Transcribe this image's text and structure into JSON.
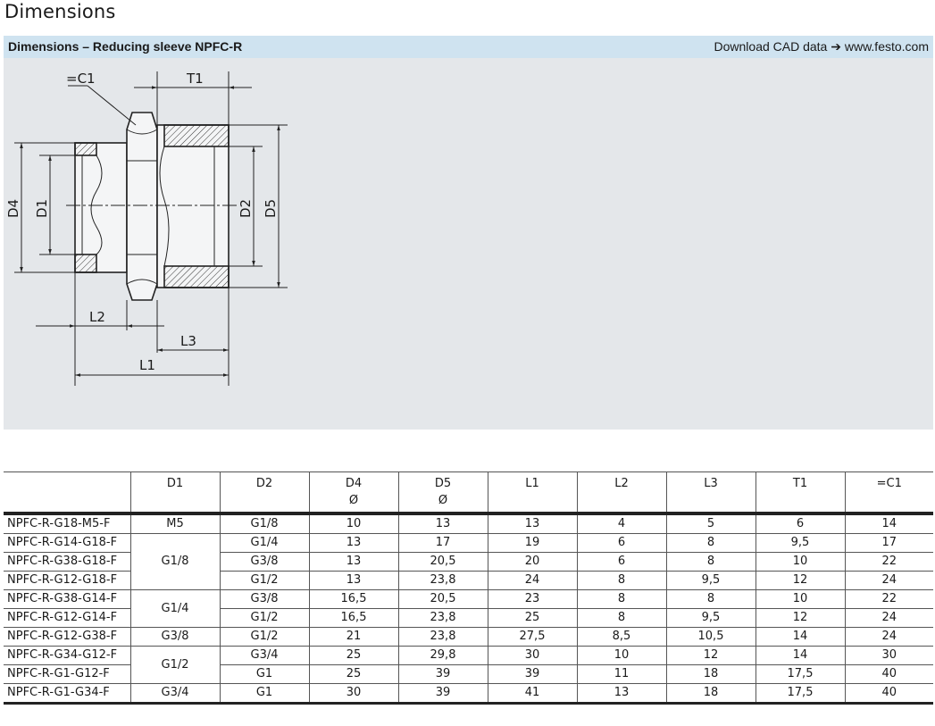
{
  "page": {
    "title": "Dimensions"
  },
  "panel": {
    "title": "Dimensions – Reducing sleeve NPFC-R",
    "cad_link": "Download CAD data ➔ www.festo.com"
  },
  "drawing": {
    "labels": {
      "wrench": "=C1",
      "t1": "T1",
      "d4": "D4",
      "d1": "D1",
      "d2": "D2",
      "d5": "D5",
      "l2": "L2",
      "l3": "L3",
      "l1": "L1"
    }
  },
  "table": {
    "headers": [
      {
        "label": "",
        "sub": ""
      },
      {
        "label": "D1",
        "sub": ""
      },
      {
        "label": "D2",
        "sub": ""
      },
      {
        "label": "D4",
        "sub": "Ø"
      },
      {
        "label": "D5",
        "sub": "Ø"
      },
      {
        "label": "L1",
        "sub": ""
      },
      {
        "label": "L2",
        "sub": ""
      },
      {
        "label": "L3",
        "sub": ""
      },
      {
        "label": "T1",
        "sub": ""
      },
      {
        "label": "=C1",
        "sub": ""
      }
    ],
    "d1_groups": [
      {
        "value": "M5",
        "rows": 1
      },
      {
        "value": "G1/8",
        "rows": 3
      },
      {
        "value": "G1/4",
        "rows": 2
      },
      {
        "value": "G3/8",
        "rows": 1
      },
      {
        "value": "G1/2",
        "rows": 2
      },
      {
        "value": "G3/4",
        "rows": 1
      }
    ],
    "rows": [
      [
        "NPFC-R-G18-M5-F",
        "G1/8",
        "10",
        "13",
        "13",
        "4",
        "5",
        "6",
        "14"
      ],
      [
        "NPFC-R-G14-G18-F",
        "G1/4",
        "13",
        "17",
        "19",
        "6",
        "8",
        "9,5",
        "17"
      ],
      [
        "NPFC-R-G38-G18-F",
        "G3/8",
        "13",
        "20,5",
        "20",
        "6",
        "8",
        "10",
        "22"
      ],
      [
        "NPFC-R-G12-G18-F",
        "G1/2",
        "13",
        "23,8",
        "24",
        "8",
        "9,5",
        "12",
        "24"
      ],
      [
        "NPFC-R-G38-G14-F",
        "G3/8",
        "16,5",
        "20,5",
        "23",
        "8",
        "8",
        "10",
        "22"
      ],
      [
        "NPFC-R-G12-G14-F",
        "G1/2",
        "16,5",
        "23,8",
        "25",
        "8",
        "9,5",
        "12",
        "24"
      ],
      [
        "NPFC-R-G12-G38-F",
        "G1/2",
        "21",
        "23,8",
        "27,5",
        "8,5",
        "10,5",
        "14",
        "24"
      ],
      [
        "NPFC-R-G34-G12-F",
        "G3/4",
        "25",
        "29,8",
        "30",
        "10",
        "12",
        "14",
        "30"
      ],
      [
        "NPFC-R-G1-G12-F",
        "G1",
        "25",
        "39",
        "39",
        "11",
        "18",
        "17,5",
        "40"
      ],
      [
        "NPFC-R-G1-G34-F",
        "G1",
        "30",
        "39",
        "41",
        "13",
        "18",
        "17,5",
        "40"
      ]
    ]
  }
}
